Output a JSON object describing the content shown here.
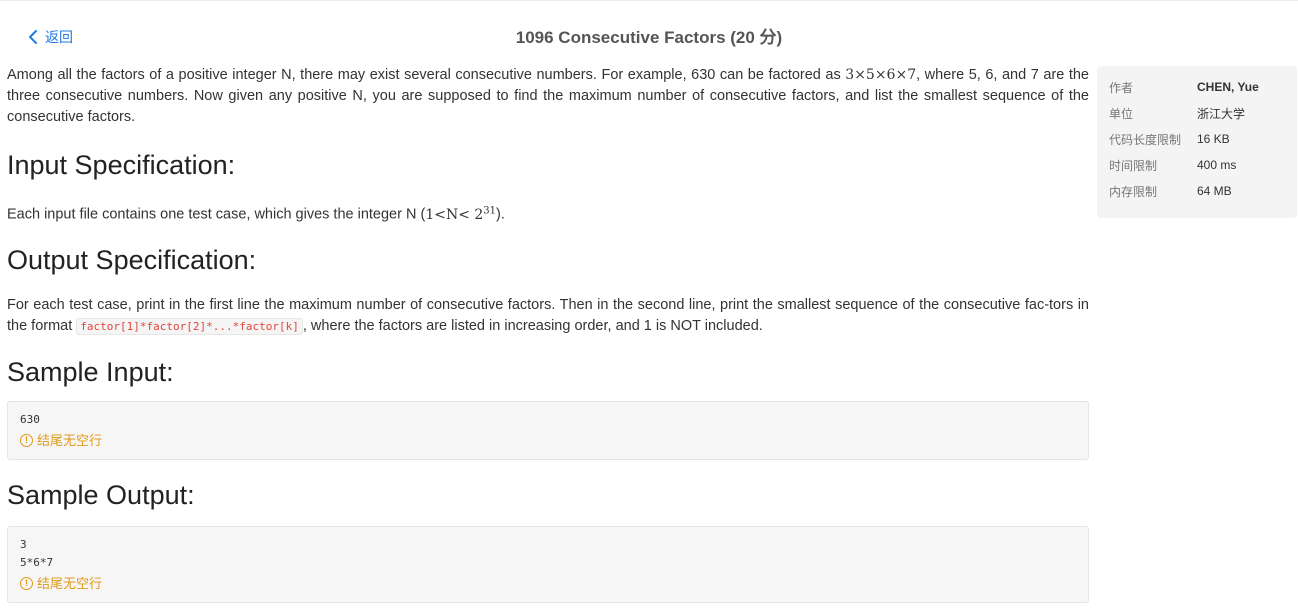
{
  "header": {
    "back_label": "返回",
    "title": "1096 Consecutive Factors (20 分)"
  },
  "problem": {
    "description_parts": [
      "Among all the factors of a positive integer N, there may exist several consecutive numbers. For example, 630 can be factored as ",
      "3×5×6×7",
      ", where 5, 6, and 7 are the three consecutive numbers. Now given any positive N, you are supposed to find the maximum number of consecutive factors, and list the smallest sequence of the consecutive factors."
    ],
    "input_heading": "Input Specification:",
    "input_text_before": "Each input file contains one test case, which gives the integer N (",
    "input_math_base": "1<N< 2",
    "input_math_exp": "31",
    "input_text_after": ").",
    "output_heading": "Output Specification:",
    "output_text_before": "For each test case, print in the first line the maximum number of consecutive factors. Then in the second line, print the smallest sequence of the consecutive fac-tors in the format ",
    "output_code": "factor[1]*factor[2]*...*factor[k]",
    "output_text_after": ", where the factors are listed in increasing order, and 1 is NOT included.",
    "sample_input_heading": "Sample Input:",
    "sample_input": "630",
    "sample_output_heading": "Sample Output:",
    "sample_output": "3\n5*6*7",
    "no_trailing_newline": "结尾无空行",
    "warn_icon": "!"
  },
  "info": {
    "rows": [
      {
        "key": "作者",
        "value": "CHEN, Yue"
      },
      {
        "key": "单位",
        "value": "浙江大学"
      },
      {
        "key": "代码长度限制",
        "value": "16 KB"
      },
      {
        "key": "时间限制",
        "value": "400 ms"
      },
      {
        "key": "内存限制",
        "value": "64 MB"
      }
    ]
  },
  "colors": {
    "link": "#1e7be3",
    "warning": "#e09a1a",
    "code": "#e0453a"
  }
}
